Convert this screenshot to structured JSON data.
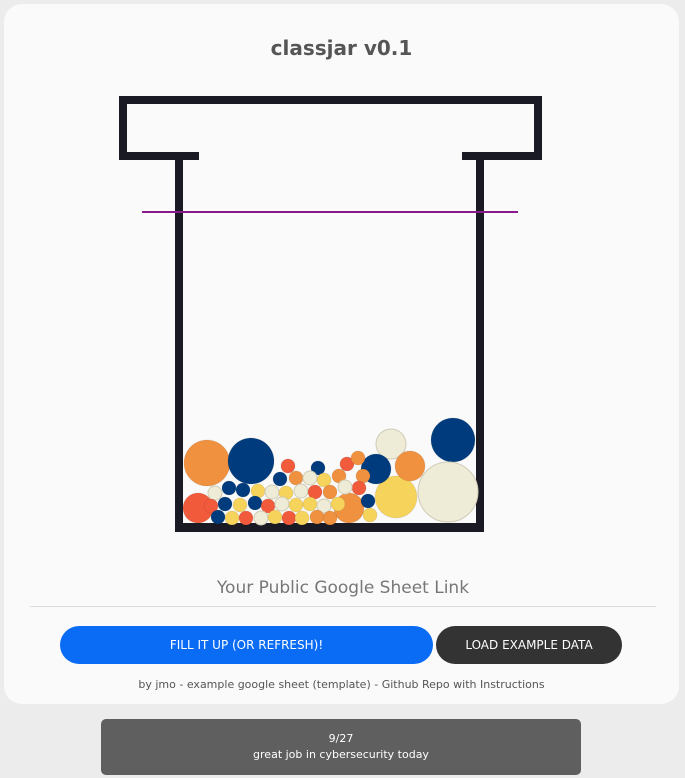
{
  "app": {
    "title": "classjar v0.1"
  },
  "form": {
    "sheet_placeholder": "Your Public Google Sheet Link"
  },
  "buttons": {
    "fill_label": "FILL IT UP (OR REFRESH)!",
    "load_label": "LOAD EXAMPLE DATA"
  },
  "credits": {
    "by": "by jmo",
    "sep1": " - ",
    "sheet_link": "example google sheet (template)",
    "sep2": " - ",
    "repo_link": "Github Repo with Instructions"
  },
  "toast": {
    "count": "9/27",
    "message": "great job in cybersecurity today"
  },
  "colors": {
    "jar": "#1a1a24",
    "goal_line": "#8a1a8a",
    "marbles": [
      "#f0913f",
      "#003c7d",
      "#f25a3c",
      "#f6d35a",
      "#eeebd7"
    ]
  }
}
